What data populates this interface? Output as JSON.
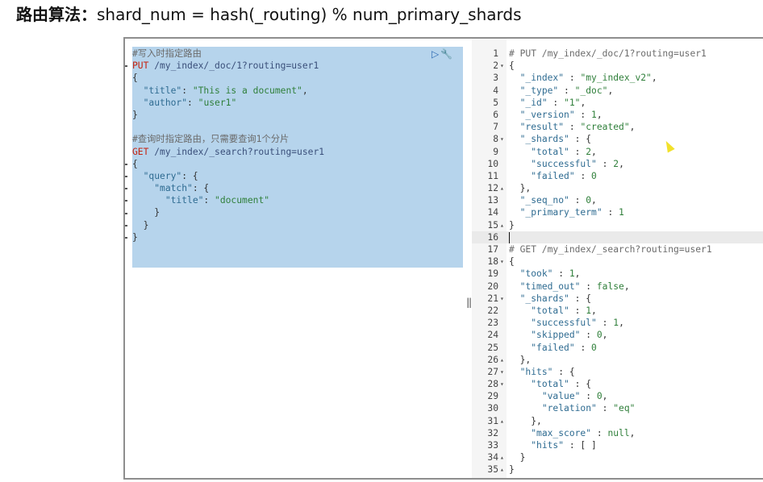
{
  "heading": {
    "title_bold": "路由算法：",
    "formula": "shard_num = hash(_routing) % num_primary_shards"
  },
  "request": {
    "lines": [
      [
        {
          "t": "#写入时指定路由",
          "c": "c-comment"
        }
      ],
      [
        {
          "t": "PUT",
          "c": "c-method"
        },
        {
          "t": " /my_index/_doc/1?routing=user1",
          "c": "c-url"
        }
      ],
      [
        {
          "t": "{",
          "c": "c-punc"
        }
      ],
      [
        {
          "t": "  ",
          "c": "c-punc"
        },
        {
          "t": "\"title\"",
          "c": "c-key"
        },
        {
          "t": ": ",
          "c": "c-punc"
        },
        {
          "t": "\"This is a document\"",
          "c": "c-str"
        },
        {
          "t": ",",
          "c": "c-punc"
        }
      ],
      [
        {
          "t": "  ",
          "c": "c-punc"
        },
        {
          "t": "\"author\"",
          "c": "c-key"
        },
        {
          "t": ": ",
          "c": "c-punc"
        },
        {
          "t": "\"user1\"",
          "c": "c-str"
        }
      ],
      [
        {
          "t": "}",
          "c": "c-punc"
        }
      ],
      [
        {
          "t": "",
          "c": "c-punc"
        }
      ],
      [
        {
          "t": "#查询时指定路由，只需要查询1个分片",
          "c": "c-comment"
        }
      ],
      [
        {
          "t": "GET",
          "c": "c-method"
        },
        {
          "t": " /my_index/_search?routing=user1",
          "c": "c-url"
        }
      ],
      [
        {
          "t": "{",
          "c": "c-punc"
        }
      ],
      [
        {
          "t": "  ",
          "c": "c-punc"
        },
        {
          "t": "\"query\"",
          "c": "c-key"
        },
        {
          "t": ": {",
          "c": "c-punc"
        }
      ],
      [
        {
          "t": "    ",
          "c": "c-punc"
        },
        {
          "t": "\"match\"",
          "c": "c-key"
        },
        {
          "t": ": {",
          "c": "c-punc"
        }
      ],
      [
        {
          "t": "      ",
          "c": "c-punc"
        },
        {
          "t": "\"title\"",
          "c": "c-key"
        },
        {
          "t": ": ",
          "c": "c-punc"
        },
        {
          "t": "\"document\"",
          "c": "c-str"
        }
      ],
      [
        {
          "t": "    }",
          "c": "c-punc"
        }
      ],
      [
        {
          "t": "  }",
          "c": "c-punc"
        }
      ],
      [
        {
          "t": "}",
          "c": "c-punc"
        }
      ]
    ],
    "actions": {
      "run_icon": "play-icon",
      "settings_icon": "wrench-icon"
    }
  },
  "response": {
    "lines": [
      {
        "n": "1",
        "f": "",
        "active": false,
        "segs": [
          {
            "t": "# PUT /my_index/_doc/1?routing=user1",
            "c": "c-comment"
          }
        ]
      },
      {
        "n": "2",
        "f": "▾",
        "active": false,
        "segs": [
          {
            "t": "{",
            "c": "c-punc"
          }
        ]
      },
      {
        "n": "3",
        "f": "",
        "active": false,
        "segs": [
          {
            "t": "  ",
            "c": "c-punc"
          },
          {
            "t": "\"_index\"",
            "c": "c-key"
          },
          {
            "t": " : ",
            "c": "c-punc"
          },
          {
            "t": "\"my_index_v2\"",
            "c": "c-str"
          },
          {
            "t": ",",
            "c": "c-punc"
          }
        ]
      },
      {
        "n": "4",
        "f": "",
        "active": false,
        "segs": [
          {
            "t": "  ",
            "c": "c-punc"
          },
          {
            "t": "\"_type\"",
            "c": "c-key"
          },
          {
            "t": " : ",
            "c": "c-punc"
          },
          {
            "t": "\"_doc\"",
            "c": "c-str"
          },
          {
            "t": ",",
            "c": "c-punc"
          }
        ]
      },
      {
        "n": "5",
        "f": "",
        "active": false,
        "segs": [
          {
            "t": "  ",
            "c": "c-punc"
          },
          {
            "t": "\"_id\"",
            "c": "c-key"
          },
          {
            "t": " : ",
            "c": "c-punc"
          },
          {
            "t": "\"1\"",
            "c": "c-str"
          },
          {
            "t": ",",
            "c": "c-punc"
          }
        ]
      },
      {
        "n": "6",
        "f": "",
        "active": false,
        "segs": [
          {
            "t": "  ",
            "c": "c-punc"
          },
          {
            "t": "\"_version\"",
            "c": "c-key"
          },
          {
            "t": " : ",
            "c": "c-punc"
          },
          {
            "t": "1",
            "c": "c-num"
          },
          {
            "t": ",",
            "c": "c-punc"
          }
        ]
      },
      {
        "n": "7",
        "f": "",
        "active": false,
        "segs": [
          {
            "t": "  ",
            "c": "c-punc"
          },
          {
            "t": "\"result\"",
            "c": "c-key"
          },
          {
            "t": " : ",
            "c": "c-punc"
          },
          {
            "t": "\"created\"",
            "c": "c-str"
          },
          {
            "t": ",",
            "c": "c-punc"
          }
        ]
      },
      {
        "n": "8",
        "f": "▾",
        "active": false,
        "segs": [
          {
            "t": "  ",
            "c": "c-punc"
          },
          {
            "t": "\"_shards\"",
            "c": "c-key"
          },
          {
            "t": " : {",
            "c": "c-punc"
          }
        ]
      },
      {
        "n": "9",
        "f": "",
        "active": false,
        "segs": [
          {
            "t": "    ",
            "c": "c-punc"
          },
          {
            "t": "\"total\"",
            "c": "c-key"
          },
          {
            "t": " : ",
            "c": "c-punc"
          },
          {
            "t": "2",
            "c": "c-num"
          },
          {
            "t": ",",
            "c": "c-punc"
          }
        ]
      },
      {
        "n": "10",
        "f": "",
        "active": false,
        "segs": [
          {
            "t": "    ",
            "c": "c-punc"
          },
          {
            "t": "\"successful\"",
            "c": "c-key"
          },
          {
            "t": " : ",
            "c": "c-punc"
          },
          {
            "t": "2",
            "c": "c-num"
          },
          {
            "t": ",",
            "c": "c-punc"
          }
        ]
      },
      {
        "n": "11",
        "f": "",
        "active": false,
        "segs": [
          {
            "t": "    ",
            "c": "c-punc"
          },
          {
            "t": "\"failed\"",
            "c": "c-key"
          },
          {
            "t": " : ",
            "c": "c-punc"
          },
          {
            "t": "0",
            "c": "c-num"
          }
        ]
      },
      {
        "n": "12",
        "f": "▴",
        "active": false,
        "segs": [
          {
            "t": "  },",
            "c": "c-punc"
          }
        ]
      },
      {
        "n": "13",
        "f": "",
        "active": false,
        "segs": [
          {
            "t": "  ",
            "c": "c-punc"
          },
          {
            "t": "\"_seq_no\"",
            "c": "c-key"
          },
          {
            "t": " : ",
            "c": "c-punc"
          },
          {
            "t": "0",
            "c": "c-num"
          },
          {
            "t": ",",
            "c": "c-punc"
          }
        ]
      },
      {
        "n": "14",
        "f": "",
        "active": false,
        "segs": [
          {
            "t": "  ",
            "c": "c-punc"
          },
          {
            "t": "\"_primary_term\"",
            "c": "c-key"
          },
          {
            "t": " : ",
            "c": "c-punc"
          },
          {
            "t": "1",
            "c": "c-num"
          }
        ]
      },
      {
        "n": "15",
        "f": "▴",
        "active": false,
        "segs": [
          {
            "t": "}",
            "c": "c-punc"
          }
        ]
      },
      {
        "n": "16",
        "f": "",
        "active": true,
        "segs": [
          {
            "t": "",
            "c": "c-punc"
          }
        ],
        "cursor": true
      },
      {
        "n": "17",
        "f": "",
        "active": false,
        "segs": [
          {
            "t": "# GET /my_index/_search?routing=user1",
            "c": "c-comment"
          }
        ]
      },
      {
        "n": "18",
        "f": "▾",
        "active": false,
        "segs": [
          {
            "t": "{",
            "c": "c-punc"
          }
        ]
      },
      {
        "n": "19",
        "f": "",
        "active": false,
        "segs": [
          {
            "t": "  ",
            "c": "c-punc"
          },
          {
            "t": "\"took\"",
            "c": "c-key"
          },
          {
            "t": " : ",
            "c": "c-punc"
          },
          {
            "t": "1",
            "c": "c-num"
          },
          {
            "t": ",",
            "c": "c-punc"
          }
        ]
      },
      {
        "n": "20",
        "f": "",
        "active": false,
        "segs": [
          {
            "t": "  ",
            "c": "c-punc"
          },
          {
            "t": "\"timed_out\"",
            "c": "c-key"
          },
          {
            "t": " : ",
            "c": "c-punc"
          },
          {
            "t": "false",
            "c": "c-num"
          },
          {
            "t": ",",
            "c": "c-punc"
          }
        ]
      },
      {
        "n": "21",
        "f": "▾",
        "active": false,
        "segs": [
          {
            "t": "  ",
            "c": "c-punc"
          },
          {
            "t": "\"_shards\"",
            "c": "c-key"
          },
          {
            "t": " : {",
            "c": "c-punc"
          }
        ]
      },
      {
        "n": "22",
        "f": "",
        "active": false,
        "segs": [
          {
            "t": "    ",
            "c": "c-punc"
          },
          {
            "t": "\"total\"",
            "c": "c-key"
          },
          {
            "t": " : ",
            "c": "c-punc"
          },
          {
            "t": "1",
            "c": "c-num"
          },
          {
            "t": ",",
            "c": "c-punc"
          }
        ]
      },
      {
        "n": "23",
        "f": "",
        "active": false,
        "segs": [
          {
            "t": "    ",
            "c": "c-punc"
          },
          {
            "t": "\"successful\"",
            "c": "c-key"
          },
          {
            "t": " : ",
            "c": "c-punc"
          },
          {
            "t": "1",
            "c": "c-num"
          },
          {
            "t": ",",
            "c": "c-punc"
          }
        ]
      },
      {
        "n": "24",
        "f": "",
        "active": false,
        "segs": [
          {
            "t": "    ",
            "c": "c-punc"
          },
          {
            "t": "\"skipped\"",
            "c": "c-key"
          },
          {
            "t": " : ",
            "c": "c-punc"
          },
          {
            "t": "0",
            "c": "c-num"
          },
          {
            "t": ",",
            "c": "c-punc"
          }
        ]
      },
      {
        "n": "25",
        "f": "",
        "active": false,
        "segs": [
          {
            "t": "    ",
            "c": "c-punc"
          },
          {
            "t": "\"failed\"",
            "c": "c-key"
          },
          {
            "t": " : ",
            "c": "c-punc"
          },
          {
            "t": "0",
            "c": "c-num"
          }
        ]
      },
      {
        "n": "26",
        "f": "▴",
        "active": false,
        "segs": [
          {
            "t": "  },",
            "c": "c-punc"
          }
        ]
      },
      {
        "n": "27",
        "f": "▾",
        "active": false,
        "segs": [
          {
            "t": "  ",
            "c": "c-punc"
          },
          {
            "t": "\"hits\"",
            "c": "c-key"
          },
          {
            "t": " : {",
            "c": "c-punc"
          }
        ]
      },
      {
        "n": "28",
        "f": "▾",
        "active": false,
        "segs": [
          {
            "t": "    ",
            "c": "c-punc"
          },
          {
            "t": "\"total\"",
            "c": "c-key"
          },
          {
            "t": " : {",
            "c": "c-punc"
          }
        ]
      },
      {
        "n": "29",
        "f": "",
        "active": false,
        "segs": [
          {
            "t": "      ",
            "c": "c-punc"
          },
          {
            "t": "\"value\"",
            "c": "c-key"
          },
          {
            "t": " : ",
            "c": "c-punc"
          },
          {
            "t": "0",
            "c": "c-num"
          },
          {
            "t": ",",
            "c": "c-punc"
          }
        ]
      },
      {
        "n": "30",
        "f": "",
        "active": false,
        "segs": [
          {
            "t": "      ",
            "c": "c-punc"
          },
          {
            "t": "\"relation\"",
            "c": "c-key"
          },
          {
            "t": " : ",
            "c": "c-punc"
          },
          {
            "t": "\"eq\"",
            "c": "c-str"
          }
        ]
      },
      {
        "n": "31",
        "f": "▴",
        "active": false,
        "segs": [
          {
            "t": "    },",
            "c": "c-punc"
          }
        ]
      },
      {
        "n": "32",
        "f": "",
        "active": false,
        "segs": [
          {
            "t": "    ",
            "c": "c-punc"
          },
          {
            "t": "\"max_score\"",
            "c": "c-key"
          },
          {
            "t": " : ",
            "c": "c-punc"
          },
          {
            "t": "null",
            "c": "c-num"
          },
          {
            "t": ",",
            "c": "c-punc"
          }
        ]
      },
      {
        "n": "33",
        "f": "",
        "active": false,
        "segs": [
          {
            "t": "    ",
            "c": "c-punc"
          },
          {
            "t": "\"hits\"",
            "c": "c-key"
          },
          {
            "t": " : [ ]",
            "c": "c-punc"
          }
        ]
      },
      {
        "n": "34",
        "f": "▴",
        "active": false,
        "segs": [
          {
            "t": "  }",
            "c": "c-punc"
          }
        ]
      },
      {
        "n": "35",
        "f": "▴",
        "active": false,
        "segs": [
          {
            "t": "}",
            "c": "c-punc"
          }
        ]
      }
    ]
  },
  "divider_glyph": "‖",
  "colors": {
    "selection": "#b6d4ec",
    "method": "#c5220f",
    "string": "#2f7f3a",
    "key": "#2e6b91"
  }
}
